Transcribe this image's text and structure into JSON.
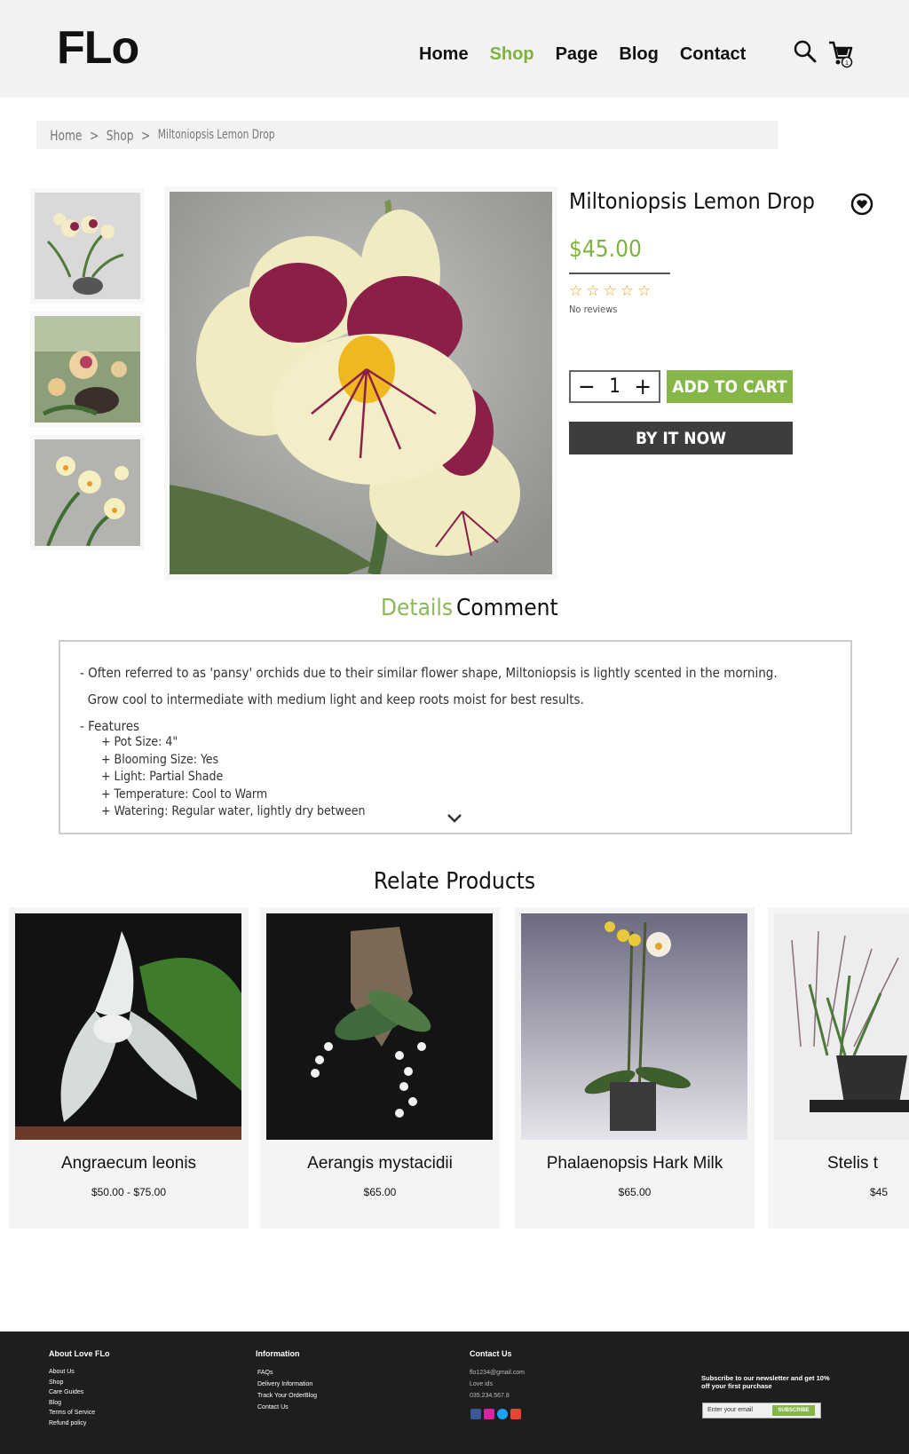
{
  "header": {
    "logo": "FLo",
    "nav": [
      "Home",
      "Shop",
      "Page",
      "Blog",
      "Contact"
    ],
    "active_nav": "Shop",
    "cart_count": "1"
  },
  "breadcrumb": {
    "home": "Home",
    "sep": ">",
    "shop": "Shop",
    "current": "Miltoniopsis Lemon Drop"
  },
  "product": {
    "title": "Miltoniopsis Lemon Drop",
    "price": "$45.00",
    "rating": 0,
    "stars": "☆☆☆☆☆",
    "reviews": "No reviews",
    "qty_minus": "−",
    "quantity": "1",
    "qty_plus": "+",
    "add_to_cart": "ADD TO CART",
    "buy_now": "BY IT NOW"
  },
  "tabs": {
    "details": "Details",
    "comment": "Comment"
  },
  "details": {
    "line1": "- Often referred to as 'pansy' orchids due to their similar flower shape, Miltoniopsis is lightly scented in the morning.",
    "line2": "  Grow cool to intermediate with medium light and keep roots moist for best results.",
    "features_label": "- Features",
    "features": [
      "+ Pot Size: 4\"",
      "+ Blooming Size: Yes",
      "+ Light: Partial Shade",
      "+ Temperature: Cool to Warm",
      "+ Watering: Regular water, lightly dry between"
    ]
  },
  "related": {
    "title": "Relate Products",
    "items": [
      {
        "name": "Angraecum leonis",
        "price": "$50.00 - $75.00"
      },
      {
        "name": "Aerangis mystacidii",
        "price": "$65.00"
      },
      {
        "name": "Phalaenopsis Hark Milk",
        "price": "$65.00"
      },
      {
        "name": "Stelis t",
        "price": "$45"
      }
    ]
  },
  "footer": {
    "about": {
      "title": "About Love FLo",
      "links": [
        "About Us",
        "Shop",
        "Care Guides",
        "Blog",
        "Terms of Service",
        "Refund policy"
      ]
    },
    "info": {
      "title": "Information",
      "links": [
        "FAQs",
        "Delivery Information",
        "Track Your OrderBlog",
        "Contact Us"
      ]
    },
    "contact": {
      "title": "Contact Us",
      "email": "flo1234@gmail.com",
      "name": "Love ids",
      "phone": "035.234.567.8"
    },
    "newsletter": {
      "text": "Subscribe to our newsletter and get 10% off your first purchase",
      "placeholder": "Enter your email",
      "button": "SUBSCRIBE"
    }
  },
  "colors": {
    "accent": "#7fb241",
    "dark": "#3d3d3d",
    "footer_bg": "#1e1e1e",
    "star": "#e8a316"
  }
}
